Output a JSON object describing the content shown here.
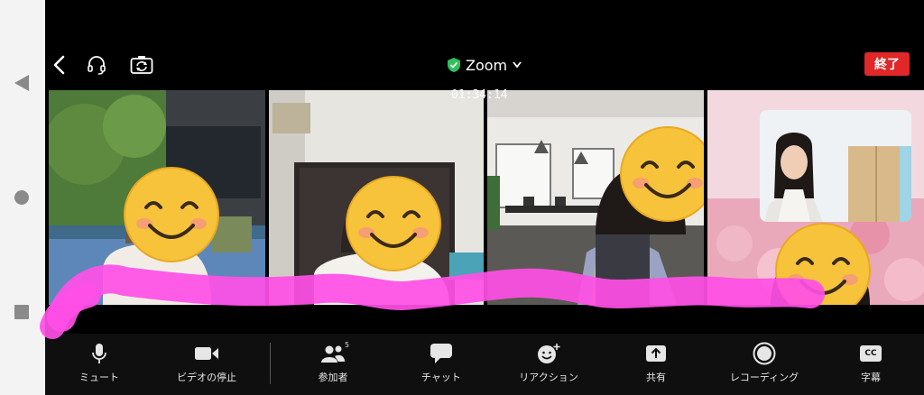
{
  "meeting": {
    "title": "Zoom",
    "timer": "01:34:14",
    "end_label": "終了"
  },
  "icons": {
    "back": "chevron-left-icon",
    "audio": "headphones-icon",
    "camera_switch": "camera-switch-icon",
    "shield": "shield-check-icon"
  },
  "colors": {
    "end_button": "#e02828",
    "shield": "#2ec25a",
    "highlighter": "#ff4fe6"
  },
  "toolbar": {
    "mute": "ミュート",
    "stop_video": "ビデオの停止",
    "participants": "参加者",
    "participants_count": "5",
    "chat": "チャット",
    "reactions": "リアクション",
    "share": "共有",
    "recording": "レコーディング",
    "captions": "字幕",
    "captions_badge": "CC"
  },
  "participants_tiles": [
    {
      "id": "tile-1"
    },
    {
      "id": "tile-2"
    },
    {
      "id": "tile-3"
    },
    {
      "id": "tile-4"
    }
  ]
}
